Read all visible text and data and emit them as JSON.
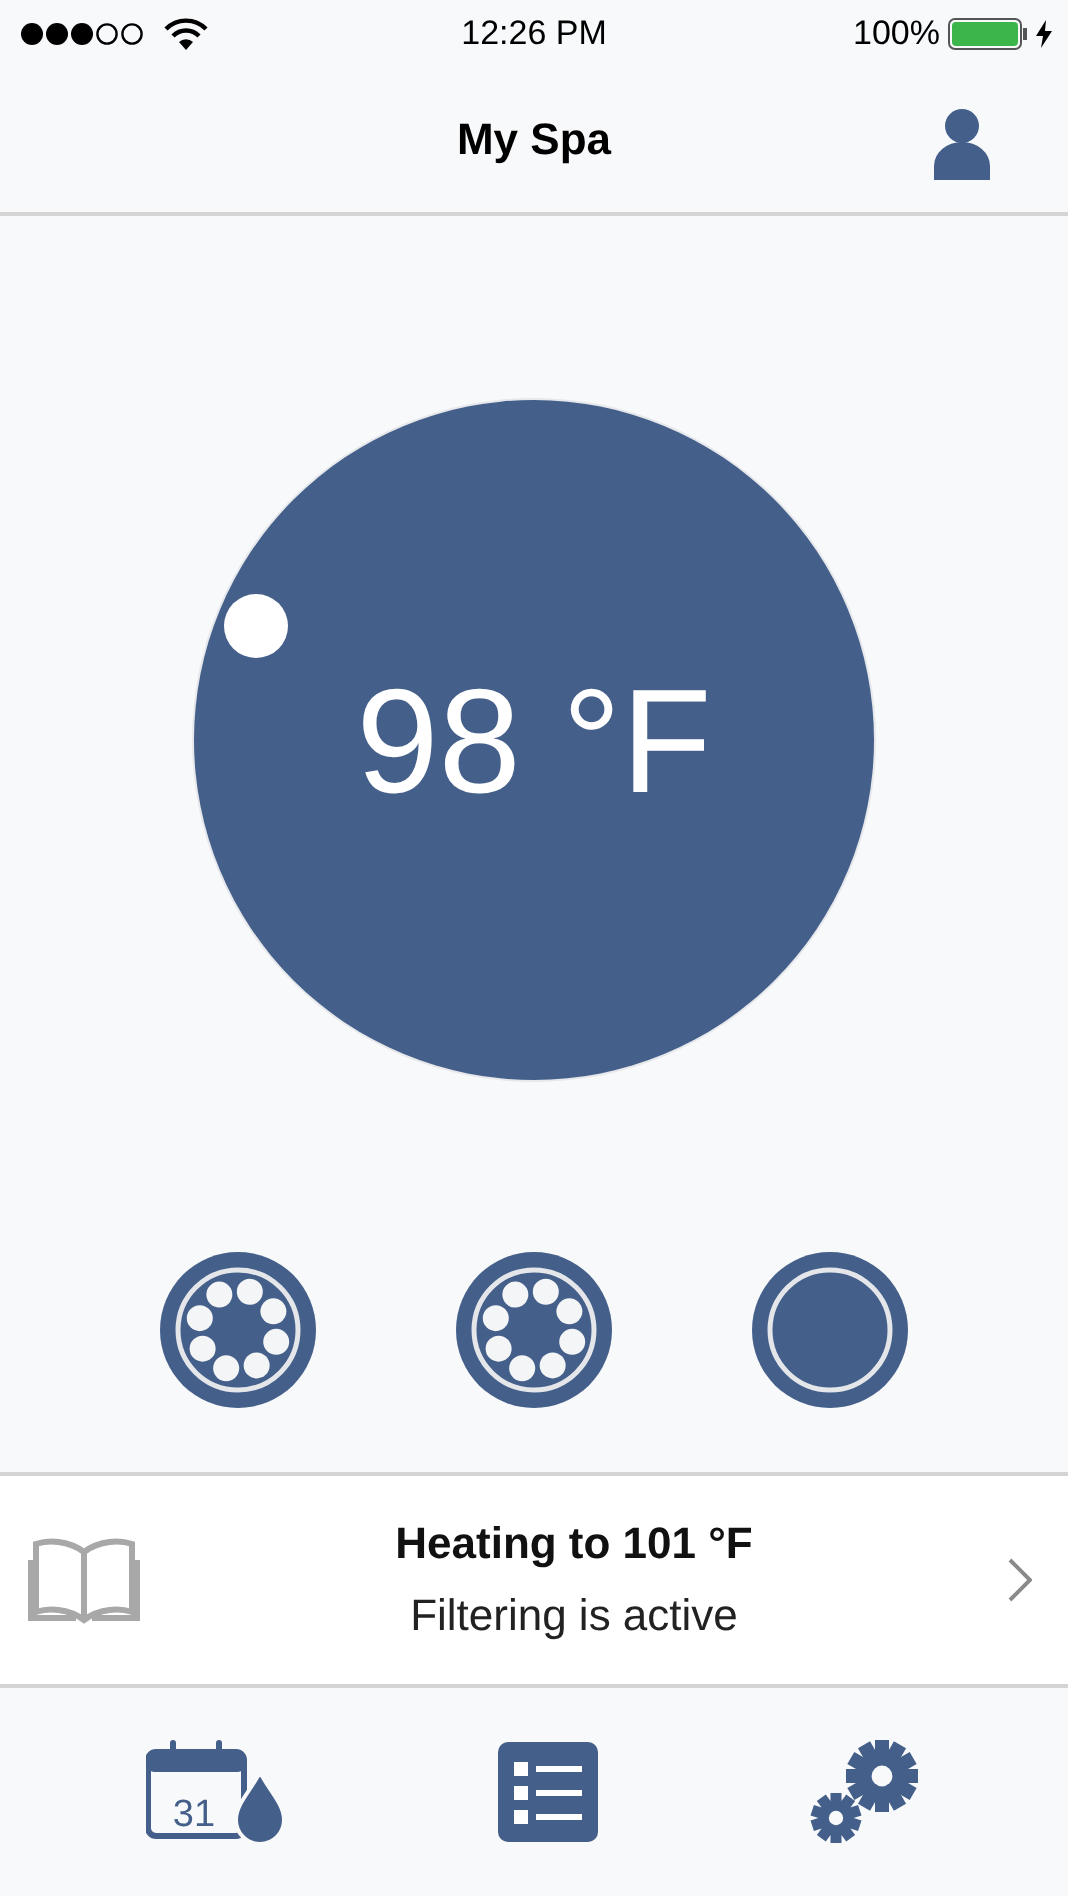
{
  "status_bar": {
    "time": "12:26 PM",
    "battery": "100%"
  },
  "nav": {
    "title": "My Spa"
  },
  "dial": {
    "temperature": "98 °F"
  },
  "controls": [
    {
      "kind": "jets"
    },
    {
      "kind": "jets"
    },
    {
      "kind": "plain"
    }
  ],
  "status": {
    "title": "Heating to 101 °F",
    "subtitle": "Filtering is active"
  },
  "tab_bar": [
    {
      "kind": "calendar",
      "day": "31"
    },
    {
      "kind": "list"
    },
    {
      "kind": "settings"
    }
  ]
}
